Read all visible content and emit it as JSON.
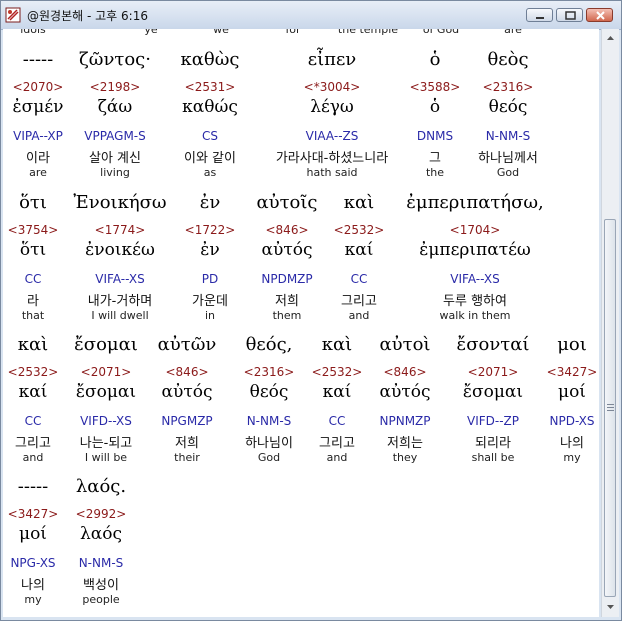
{
  "window": {
    "title": "@원경본해 - 고후 6:16",
    "controls": [
      "minimize",
      "maximize",
      "close"
    ]
  },
  "top_partial_row": [
    "idols",
    "ye",
    "we",
    "for",
    "the temple",
    "of God",
    "are"
  ],
  "rows": [
    {
      "words": [
        {
          "greek": "-----",
          "strong": "<2070>",
          "lemma": "ἐσμέν",
          "parse": "VIPA--XP",
          "kor": "이라",
          "eng": "are"
        },
        {
          "greek": "ζῶντος·",
          "strong": "<2198>",
          "lemma": "ζάω",
          "parse": "VPPAGM-S",
          "kor": "살아 계신",
          "eng": "living"
        },
        {
          "greek": "καθὼς",
          "strong": "<2531>",
          "lemma": "καθώς",
          "parse": "CS",
          "kor": "이와 같이",
          "eng": "as"
        },
        {
          "greek": "εἶπεν",
          "strong": "<*3004>",
          "lemma": "λέγω",
          "parse": "VIAA--ZS",
          "kor": "가라사대-하셨느니라",
          "eng": "hath said"
        },
        {
          "greek": "ὁ",
          "strong": "<3588>",
          "lemma": "ὁ",
          "parse": "DNMS",
          "kor": "그",
          "eng": "the"
        },
        {
          "greek": "θεὸς",
          "strong": "<2316>",
          "lemma": "θεός",
          "parse": "N-NM-S",
          "kor": "하나님께서",
          "eng": "God"
        }
      ]
    },
    {
      "words": [
        {
          "greek": "ὅτι",
          "strong": "<3754>",
          "lemma": "ὅτι",
          "parse": "CC",
          "kor": "라",
          "eng": "that"
        },
        {
          "greek": "Ἐνοικήσω",
          "strong": "<1774>",
          "lemma": "ἐνοικέω",
          "parse": "VIFA--XS",
          "kor": "내가-거하며",
          "eng": "I will dwell"
        },
        {
          "greek": "ἐν",
          "strong": "<1722>",
          "lemma": "ἐν",
          "parse": "PD",
          "kor": "가운데",
          "eng": "in"
        },
        {
          "greek": "αὐτοῖς",
          "strong": "<846>",
          "lemma": "αὐτός",
          "parse": "NPDMZP",
          "kor": "저희",
          "eng": "them"
        },
        {
          "greek": "καὶ",
          "strong": "<2532>",
          "lemma": "καί",
          "parse": "CC",
          "kor": "그리고",
          "eng": "and"
        },
        {
          "greek": "ἐμπεριπατήσω,",
          "strong": "<1704>",
          "lemma": "ἐμπεριπατέω",
          "parse": "VIFA--XS",
          "kor": "두루 행하여",
          "eng": "walk in them"
        }
      ]
    },
    {
      "words": [
        {
          "greek": "καὶ",
          "strong": "<2532>",
          "lemma": "καί",
          "parse": "CC",
          "kor": "그리고",
          "eng": "and"
        },
        {
          "greek": "ἔσομαι",
          "strong": "<2071>",
          "lemma": "ἔσομαι",
          "parse": "VIFD--XS",
          "kor": "나는-되고",
          "eng": "I will be"
        },
        {
          "greek": "αὐτῶν",
          "strong": "<846>",
          "lemma": "αὐτός",
          "parse": "NPGMZP",
          "kor": "저희",
          "eng": "their"
        },
        {
          "greek": "θεός,",
          "strong": "<2316>",
          "lemma": "θεός",
          "parse": "N-NM-S",
          "kor": "하나님이",
          "eng": "God"
        },
        {
          "greek": "καὶ",
          "strong": "<2532>",
          "lemma": "καί",
          "parse": "CC",
          "kor": "그리고",
          "eng": "and"
        },
        {
          "greek": "αὐτοὶ",
          "strong": "<846>",
          "lemma": "αὐτός",
          "parse": "NPNMZP",
          "kor": "저희는",
          "eng": "they"
        },
        {
          "greek": "ἔσονταί",
          "strong": "<2071>",
          "lemma": "ἔσομαι",
          "parse": "VIFD--ZP",
          "kor": "되리라",
          "eng": "shall be"
        },
        {
          "greek": "μοι",
          "strong": "<3427>",
          "lemma": "μοί",
          "parse": "NPD-XS",
          "kor": "나의",
          "eng": "my"
        }
      ]
    },
    {
      "words": [
        {
          "greek": "-----",
          "strong": "<3427>",
          "lemma": "μοί",
          "parse": "NPG-XS",
          "kor": "나의",
          "eng": "my"
        },
        {
          "greek": "λαός.",
          "strong": "<2992>",
          "lemma": "λαός",
          "parse": "N-NM-S",
          "kor": "백성이",
          "eng": "people"
        }
      ]
    }
  ]
}
